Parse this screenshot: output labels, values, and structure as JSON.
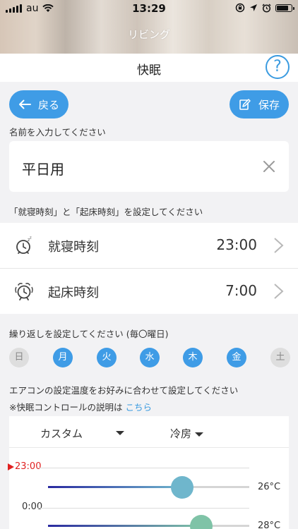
{
  "status_bar": {
    "carrier": "au",
    "time": "13:29"
  },
  "nav": {
    "title": "リビング"
  },
  "page": {
    "title": "快眠",
    "help_label": "?"
  },
  "toolbar": {
    "back_label": "戻る",
    "save_label": "保存"
  },
  "name_section": {
    "label": "名前を入力してください",
    "value": "平日用"
  },
  "time_section": {
    "label": "「就寝時刻」と「起床時刻」を設定してください",
    "bedtime": {
      "label": "就寝時刻",
      "value": "23:00"
    },
    "wakeup": {
      "label": "起床時刻",
      "value": "7:00"
    }
  },
  "repeat_section": {
    "label": "繰り返しを設定してください (毎〇曜日)",
    "days": [
      {
        "label": "日",
        "selected": false
      },
      {
        "label": "月",
        "selected": true
      },
      {
        "label": "火",
        "selected": true
      },
      {
        "label": "水",
        "selected": true
      },
      {
        "label": "木",
        "selected": true
      },
      {
        "label": "金",
        "selected": true
      },
      {
        "label": "土",
        "selected": false
      }
    ]
  },
  "temp_section": {
    "label": "エアコンの設定温度をお好みに合わせて設定してください",
    "note_prefix": "※快眠コントロールの説明は",
    "note_link": "こちら",
    "mode_custom": "カスタム",
    "mode_ac": "冷房",
    "schedule": [
      {
        "time": "23:00",
        "temp": "26°C",
        "current": true
      },
      {
        "time": "0:00",
        "temp": "28°C",
        "current": false
      }
    ]
  },
  "colors": {
    "accent": "#3f9ce6",
    "marker": "#e02020",
    "knob1": "#6fb6cc",
    "knob2": "#7fc3a7"
  }
}
